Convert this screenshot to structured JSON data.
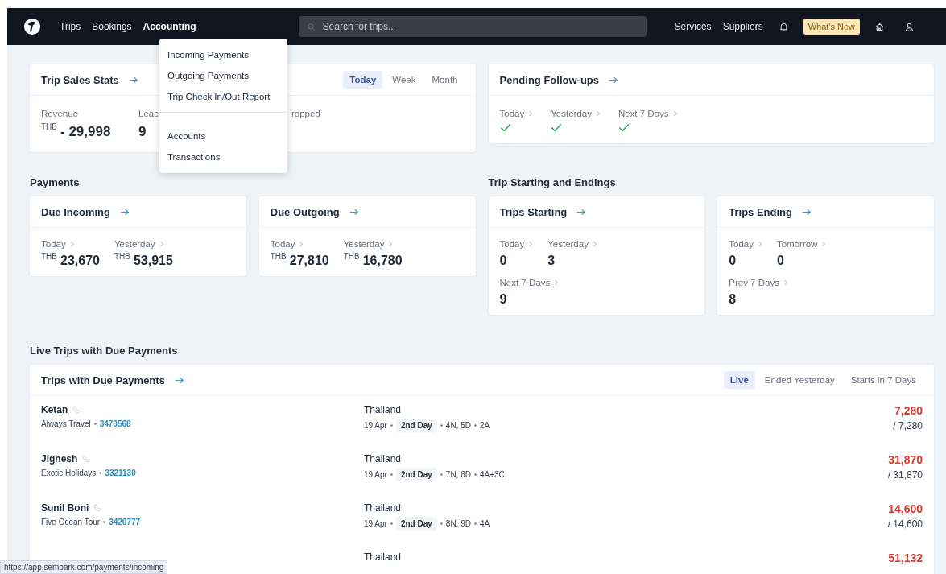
{
  "nav": {
    "links": [
      {
        "label": "Trips",
        "selected": false
      },
      {
        "label": "Bookings",
        "selected": false
      },
      {
        "label": "Accounting",
        "selected": true
      }
    ],
    "search": {
      "placeholder": "Search for trips..."
    },
    "right_links": [
      "Services",
      "Suppliers"
    ],
    "whats_new": "What's New"
  },
  "accounting_menu": {
    "groups": [
      [
        "Incoming Payments",
        "Outgoing Payments",
        "Trip Check In/Out Report"
      ],
      [
        "Accounts",
        "Transactions"
      ]
    ]
  },
  "trip_sales_stats": {
    "title": "Trip Sales Stats",
    "periods": [
      {
        "label": "Today",
        "selected": true
      },
      {
        "label": "Week",
        "selected": false
      },
      {
        "label": "Month",
        "selected": false
      }
    ],
    "stats": [
      {
        "label": "Revenue",
        "currency": "THB",
        "value": "- 29,998"
      },
      {
        "label": "Leac",
        "value": "9"
      },
      {
        "label": "ropped"
      }
    ]
  },
  "pending_follow_ups": {
    "title": "Pending Follow-ups",
    "items": [
      {
        "label": "Today",
        "done": true
      },
      {
        "label": "Yesterday",
        "done": true
      },
      {
        "label": "Next 7 Days",
        "done": true
      }
    ]
  },
  "payments": {
    "heading": "Payments",
    "cards": [
      {
        "title": "Due Incoming",
        "rows": [
          [
            {
              "label": "Today",
              "currency": "THB",
              "value": "23,670"
            },
            {
              "label": "Yesterday",
              "currency": "THB",
              "value": "53,915"
            }
          ]
        ]
      },
      {
        "title": "Due Outgoing",
        "rows": [
          [
            {
              "label": "Today",
              "currency": "THB",
              "value": "27,810"
            },
            {
              "label": "Yesterday",
              "currency": "THB",
              "value": "16,780"
            }
          ]
        ]
      }
    ]
  },
  "trip_starting_endings": {
    "heading": "Trip Starting and Endings",
    "cards": [
      {
        "title": "Trips Starting",
        "rows": [
          [
            {
              "label": "Today",
              "value": "0"
            },
            {
              "label": "Yesterday",
              "value": "3"
            }
          ],
          [
            {
              "label": "Next 7 Days",
              "value": "9"
            }
          ]
        ]
      },
      {
        "title": "Trips Ending",
        "rows": [
          [
            {
              "label": "Today",
              "value": "0"
            },
            {
              "label": "Tomorrow",
              "value": "0"
            }
          ],
          [
            {
              "label": "Prev 7 Days",
              "value": "8"
            }
          ]
        ]
      }
    ]
  },
  "live_trips": {
    "heading": "Live Trips with Due Payments",
    "title": "Trips with Due Payments",
    "tabs": [
      {
        "label": "Live",
        "selected": true
      },
      {
        "label": "Ended Yesterday",
        "selected": false
      },
      {
        "label": "Starts in 7 Days",
        "selected": false
      }
    ],
    "rows": [
      {
        "name": "Ketan",
        "agency": "Always Travel",
        "trip_id": "3473568",
        "destination": "Thailand",
        "date": "19 Apr",
        "day": "2nd Day",
        "stay": "4N, 5D",
        "pax": "2A",
        "due": "7,280",
        "total": "/ 7,280"
      },
      {
        "name": "Jignesh",
        "agency": "Exotic Holidays",
        "trip_id": "3321130",
        "destination": "Thailand",
        "date": "19 Apr",
        "day": "2nd Day",
        "stay": "7N, 8D",
        "pax": "4A+3C",
        "due": "31,870",
        "total": "/ 31,870"
      },
      {
        "name": "Sunil Boni",
        "agency": "Five Ocean Tour",
        "trip_id": "3420777",
        "destination": "Thailand",
        "date": "19 Apr",
        "day": "2nd Day",
        "stay": "8N, 9D",
        "pax": "4A",
        "due": "14,600",
        "total": "/ 14,600"
      },
      {
        "destination": "Thailand",
        "due": "51,132"
      }
    ]
  },
  "status_url": "https://app.sembark.com/payments/incoming"
}
